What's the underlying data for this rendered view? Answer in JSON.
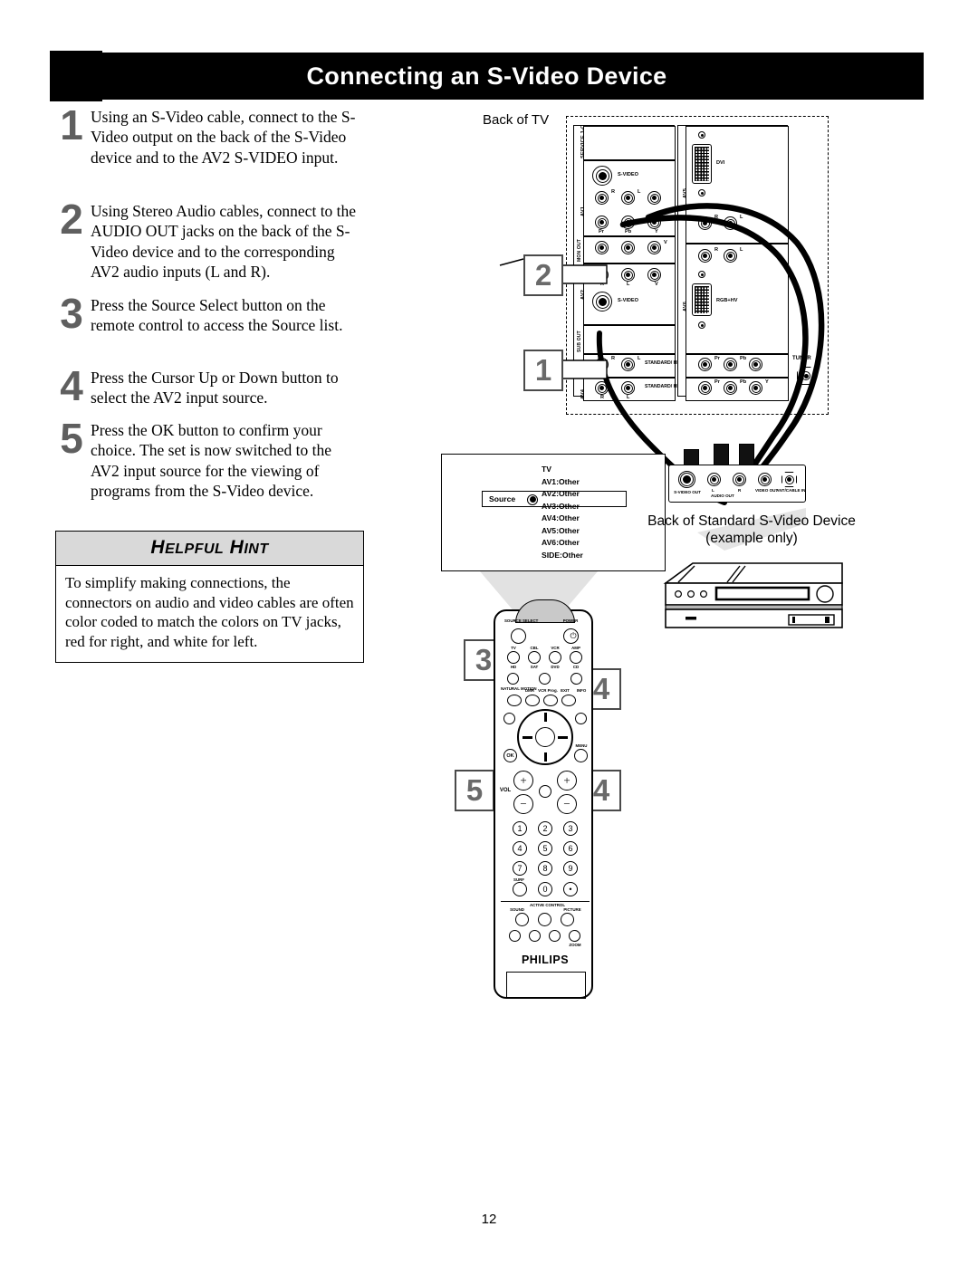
{
  "header": {
    "title": "Connecting an S-Video Device",
    "icon": "cables-icon"
  },
  "steps": [
    {
      "number": "1",
      "text": "Using an S-Video cable, connect to the S-Video output on the back of the S-Video device and to the AV2 S-VIDEO input."
    },
    {
      "number": "2",
      "text": "Using Stereo Audio cables, connect to the AUDIO OUT jacks on the back of the S-Video device and to the corresponding AV2 audio inputs (L and R)."
    },
    {
      "number": "3",
      "text": "Press the Source Select button on the remote control to access the Source list."
    },
    {
      "number": "4",
      "text": "Press the Cursor Up or Down button to select the AV2 input source."
    },
    {
      "number": "5",
      "text": "Press the OK button to confirm your choice. The set is now switched to the AV2 input source for the viewing of programs from the S-Video device."
    }
  ],
  "hint": {
    "title_first": "H",
    "title_first_rest": "ELPFUL",
    "title_second": "H",
    "title_second_rest": "INT",
    "body": "To simplify making connections, the connectors on audio and video cables are often color coded to match the colors on TV jacks, red for right, and white for left."
  },
  "diagram": {
    "back_of_tv_label": "Back of TV",
    "callouts": [
      "2",
      "1",
      "3",
      "4",
      "4",
      "5"
    ],
    "tv_panel": {
      "left_column_labels": [
        "SERVICE 1-C",
        "AV1",
        "MON OUT",
        "AV2",
        "SUB OUT",
        "AV3",
        "AV4"
      ],
      "right_column_labels": [
        "AV5",
        "AV6"
      ],
      "jack_labels": {
        "svideo": "S-VIDEO",
        "r": "R",
        "l": "L",
        "v": "V",
        "y": "Y",
        "pr": "Pr",
        "pb": "Pb",
        "dvi": "DVI",
        "rgb_hv": "RGB+HV",
        "standard_hd": "STANDARD/ HD INPUTS",
        "tuner": "TUNER"
      }
    },
    "source_menu": {
      "source_label": "Source",
      "items": [
        "TV",
        "AV1:Other",
        "AV2:Other",
        "AV3:Other",
        "AV4:Other",
        "AV5:Other",
        "AV6:Other",
        "SIDE:Other"
      ],
      "selected": "AV2:Other"
    },
    "device": {
      "caption_line1": "Back of Standard S-Video Device",
      "caption_line2": "(example only)",
      "jack_labels": [
        "S-VIDEO OUT",
        "L",
        "AUDIO OUT",
        "R",
        "VIDEO OUT",
        "ANT/CABLE IN"
      ]
    },
    "remote": {
      "brand": "PHILIPS",
      "labels": {
        "source_select": "SOURCE SELECT",
        "power": "POWER",
        "tv": "TV",
        "cbl": "CBL",
        "vcr": "VCR",
        "amp": "AMP",
        "hd": "HD",
        "sat": "SAT",
        "dvd": "DVD",
        "cd": "CD",
        "natural_motion": "NATURAL MOTION",
        "dmr": "DMR",
        "vcr_prog": "VCR Prog.",
        "exit": "EXIT",
        "info": "INFO",
        "ok": "OK",
        "menu": "MENU",
        "vol": "VOL",
        "surf": "SURF",
        "active_control": "ACTIVE CONTROL",
        "sound": "SOUND",
        "picture": "PICTURE",
        "zoom": "ZOOM"
      },
      "keypad": [
        "1",
        "2",
        "3",
        "4",
        "5",
        "6",
        "7",
        "8",
        "9",
        "0"
      ]
    }
  },
  "page_number": "12",
  "colors": {
    "header_band": "#000000",
    "header_text": "#ffffff",
    "step_number": "#5f5f5f",
    "hint_header_bg": "#d9d9d9",
    "callout_border": "#4a4a4a",
    "callout_text": "#6a6a6a"
  }
}
